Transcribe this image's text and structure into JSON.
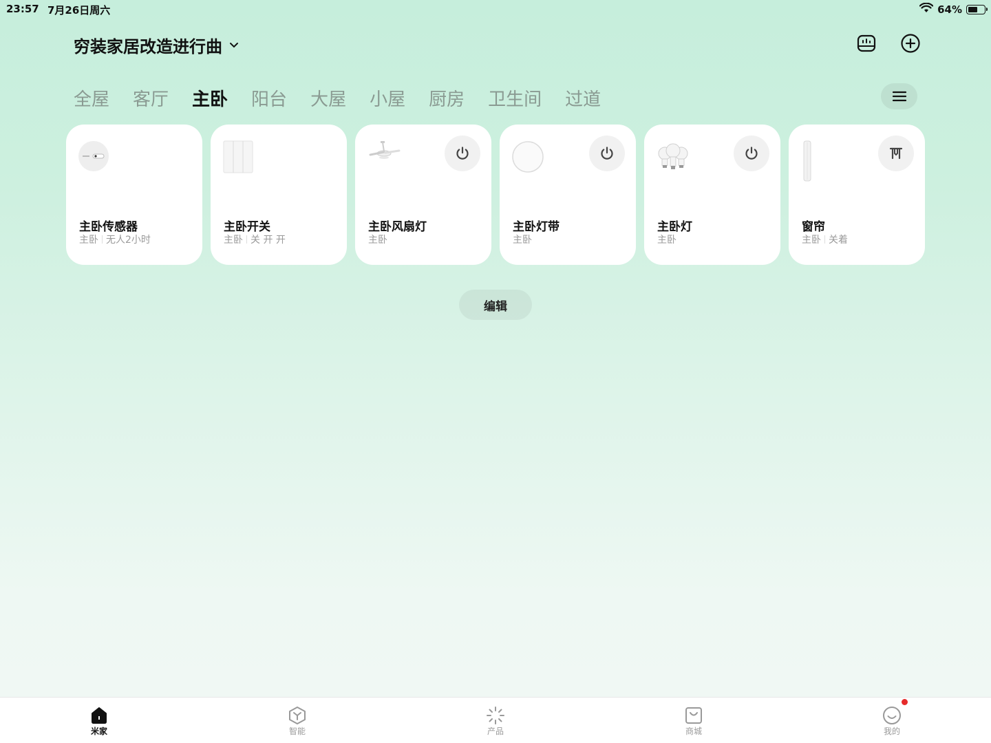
{
  "status": {
    "time": "23:57",
    "date": "7月26日周六",
    "battery": "64%",
    "battery_level": 0.64
  },
  "home": {
    "title": "穷装家居改造进行曲"
  },
  "tabs": [
    {
      "label": "全屋",
      "active": false
    },
    {
      "label": "客厅",
      "active": false
    },
    {
      "label": "主卧",
      "active": true
    },
    {
      "label": "阳台",
      "active": false
    },
    {
      "label": "大屋",
      "active": false
    },
    {
      "label": "小屋",
      "active": false
    },
    {
      "label": "厨房",
      "active": false
    },
    {
      "label": "卫生间",
      "active": false
    },
    {
      "label": "过道",
      "active": false
    }
  ],
  "devices": [
    {
      "name": "主卧传感器",
      "room": "主卧",
      "state": "无人2小时",
      "icon": "sensor-icon",
      "power_btn": false
    },
    {
      "name": "主卧开关",
      "room": "主卧",
      "state": "关 开 开",
      "icon": "switch-icon",
      "power_btn": false
    },
    {
      "name": "主卧风扇灯",
      "room": "主卧",
      "state": "",
      "icon": "fan-light-icon",
      "power_btn": true
    },
    {
      "name": "主卧灯带",
      "room": "主卧",
      "state": "",
      "icon": "light-strip-icon",
      "power_btn": true
    },
    {
      "name": "主卧灯",
      "room": "主卧",
      "state": "",
      "icon": "bulbs-icon",
      "power_btn": true
    },
    {
      "name": "窗帘",
      "room": "主卧",
      "state": "关着",
      "icon": "curtain-icon",
      "power_btn": true,
      "btn_glyph": "curtain-toggle-icon"
    }
  ],
  "edit_label": "编辑",
  "nav": [
    {
      "label": "米家",
      "icon": "home-icon",
      "active": true
    },
    {
      "label": "智能",
      "icon": "smart-icon",
      "active": false
    },
    {
      "label": "产品",
      "icon": "product-icon",
      "active": false
    },
    {
      "label": "商城",
      "icon": "shop-icon",
      "active": false
    },
    {
      "label": "我的",
      "icon": "profile-icon",
      "active": false,
      "badge": true
    }
  ]
}
